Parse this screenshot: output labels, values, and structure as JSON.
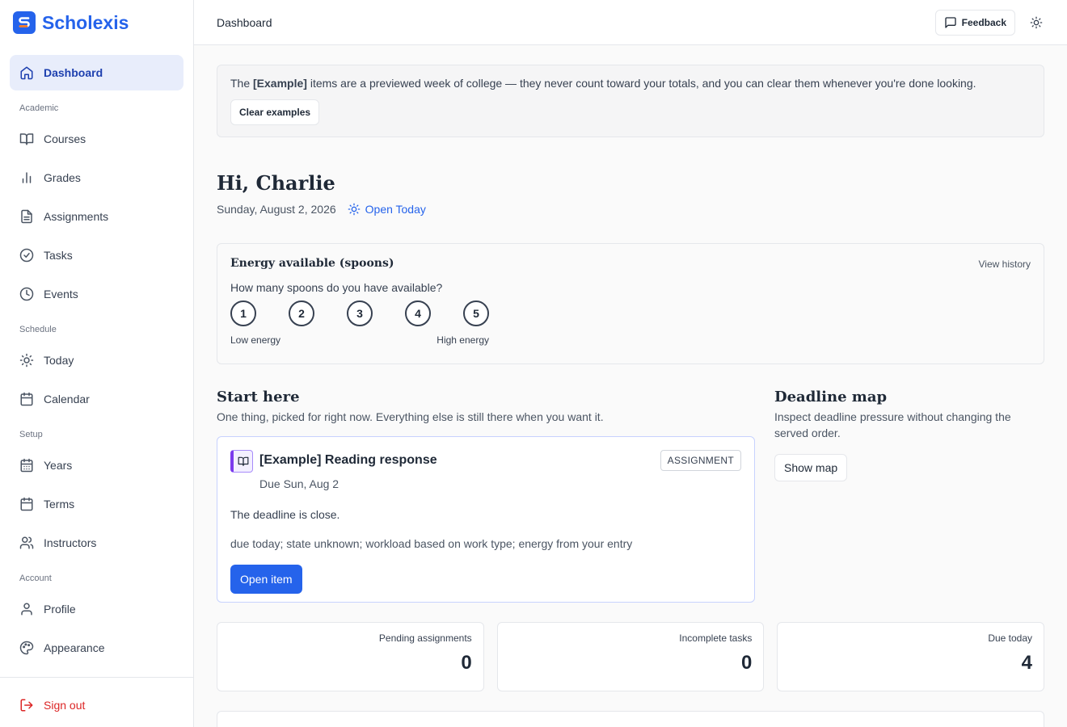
{
  "brand": {
    "name": "Scholexis",
    "logo_letter": "S"
  },
  "sidebar": {
    "dashboard": "Dashboard",
    "sections": {
      "academic": "Academic",
      "schedule": "Schedule",
      "setup": "Setup",
      "account": "Account"
    },
    "items": {
      "courses": "Courses",
      "grades": "Grades",
      "assignments": "Assignments",
      "tasks": "Tasks",
      "events": "Events",
      "today": "Today",
      "calendar": "Calendar",
      "years": "Years",
      "terms": "Terms",
      "instructors": "Instructors",
      "profile": "Profile",
      "appearance": "Appearance"
    },
    "sign_out": "Sign out"
  },
  "topbar": {
    "breadcrumb": "Dashboard",
    "feedback": "Feedback"
  },
  "notice": {
    "prefix": "The ",
    "highlight": "[Example]",
    "suffix": " items are a previewed week of college — they never count toward your totals, and you can clear them whenever you're done looking.",
    "button": "Clear examples"
  },
  "greeting": "Hi, Charlie",
  "date": "Sunday, August 2, 2026",
  "open_today": "Open Today",
  "energy": {
    "title": "Energy available (spoons)",
    "history": "View history",
    "question": "How many spoons do you have available?",
    "options": [
      "1",
      "2",
      "3",
      "4",
      "5"
    ],
    "low_label": "Low energy",
    "high_label": "High energy"
  },
  "start_here": {
    "title": "Start here",
    "subtitle": "One thing, picked for right now. Everything else is still there when you want it.",
    "card": {
      "title": "[Example] Reading response",
      "due": "Due Sun, Aug 2",
      "tag": "ASSIGNMENT",
      "reason": "The deadline is close.",
      "detail": "due today; state unknown; workload based on work type; energy from your entry",
      "button": "Open item"
    }
  },
  "deadline_map": {
    "title": "Deadline map",
    "subtitle": "Inspect deadline pressure without changing the served order.",
    "button": "Show map"
  },
  "stats": [
    {
      "label": "Pending assignments",
      "value": "0"
    },
    {
      "label": "Incomplete tasks",
      "value": "0"
    },
    {
      "label": "Due today",
      "value": "4"
    }
  ],
  "colors": {
    "accent": "#2563eb",
    "danger": "#dc2626",
    "active_bg": "#e8edfb"
  }
}
